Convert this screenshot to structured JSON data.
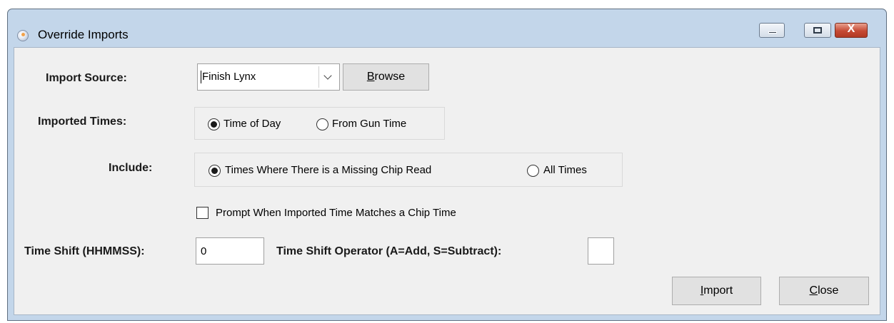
{
  "window": {
    "title": "Override Imports",
    "close_glyph": "X"
  },
  "form": {
    "import_source_label": "Import Source:",
    "import_source_value": "Finish Lynx",
    "browse_label_rest": "rowse",
    "browse_label_mnemonic": "B",
    "imported_times_label": "Imported Times:",
    "imported_times_options": [
      "Time of Day",
      "From Gun Time"
    ],
    "imported_times_selected": "Time of Day",
    "include_label": "Include:",
    "include_options": [
      "Times Where There is a Missing Chip Read",
      "All Times"
    ],
    "include_selected": "Times Where There is a Missing Chip Read",
    "prompt_checkbox_label": "Prompt When Imported Time Matches a Chip Time",
    "prompt_checkbox_checked": false,
    "time_shift_label": "Time Shift (HHMMSS):",
    "time_shift_value": "0",
    "operator_label": "Time Shift Operator (A=Add, S=Subtract):",
    "operator_value": ""
  },
  "buttons": {
    "import_mnemonic": "I",
    "import_rest": "mport",
    "close_mnemonic": "C",
    "close_rest": "lose"
  },
  "icons": {
    "app": "app-icon",
    "minimize": "minimize-icon",
    "maximize": "maximize-icon",
    "close": "close-icon",
    "dropdown": "chevron-down-icon"
  }
}
